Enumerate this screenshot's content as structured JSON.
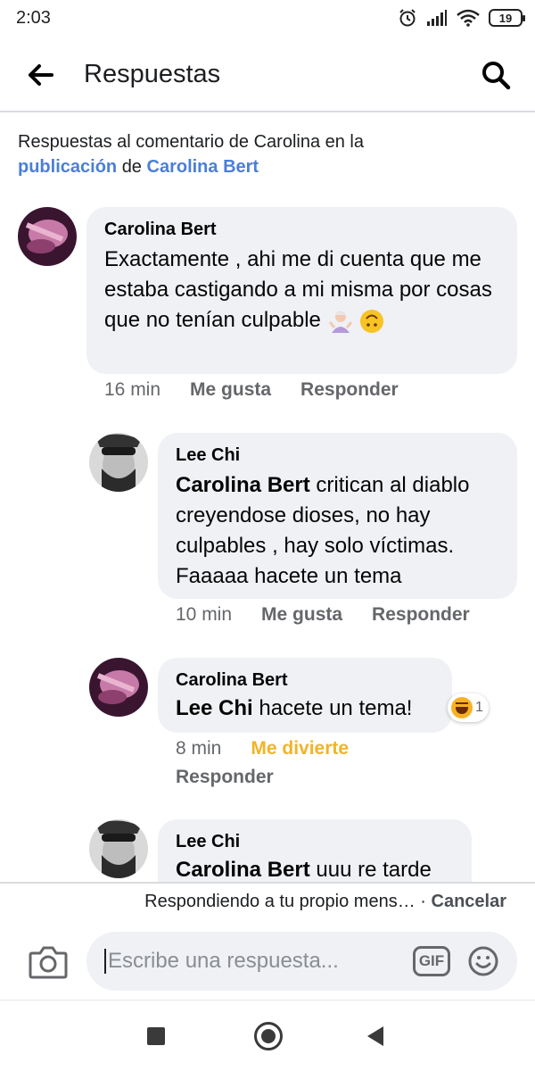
{
  "status_bar": {
    "time": "2:03",
    "battery": "19",
    "icons": [
      "alarm-icon",
      "signal-icon",
      "wifi-icon",
      "battery-icon"
    ]
  },
  "header": {
    "title": "Respuestas",
    "back_icon": "arrow-left-icon",
    "search_icon": "search-icon"
  },
  "context": {
    "prefix": "Respuestas al comentario de Carolina en la",
    "link1": "publicación",
    "mid": "de",
    "link2": "Carolina Bert"
  },
  "comments": [
    {
      "author": "Carolina Bert",
      "text": "Exactamente , ahi me di cuenta que me estaba castigando a mi misma por cosas que no tenían culpable",
      "emojis": [
        "person-shrugging-emoji",
        "upside-down-face-emoji"
      ],
      "time": "16 min",
      "like": "Me gusta",
      "reply": "Responder"
    },
    {
      "author": "Lee Chi",
      "mention": "Carolina Bert",
      "text": "critican al diablo creyendose dioses, no hay culpables , hay solo víctimas. Faaaaa hacete un tema",
      "time": "10 min",
      "like": "Me gusta",
      "reply": "Responder"
    },
    {
      "author": "Carolina Bert",
      "mention": "Lee Chi",
      "text": "hacete un tema!",
      "reaction_count": "1",
      "reaction_icon": "laughing-reaction-icon",
      "time": "8 min",
      "like": "Me divierte",
      "reply": "Responder"
    },
    {
      "author": "Lee Chi",
      "mention": "Carolina Bert",
      "text": "uuu re tarde"
    }
  ],
  "reply_bar": {
    "text": "Respondiendo a tu propio mens…",
    "separator": "·",
    "cancel": "Cancelar"
  },
  "composer": {
    "placeholder": "Escribe una respuesta...",
    "gif": "GIF",
    "camera_icon": "camera-icon",
    "emoji_icon": "smiley-icon"
  },
  "colors": {
    "link": "#4a7fd6",
    "bubble": "#eff1f5",
    "meta": "#65676b",
    "divierte": "#f0b429",
    "text": "#050505"
  }
}
